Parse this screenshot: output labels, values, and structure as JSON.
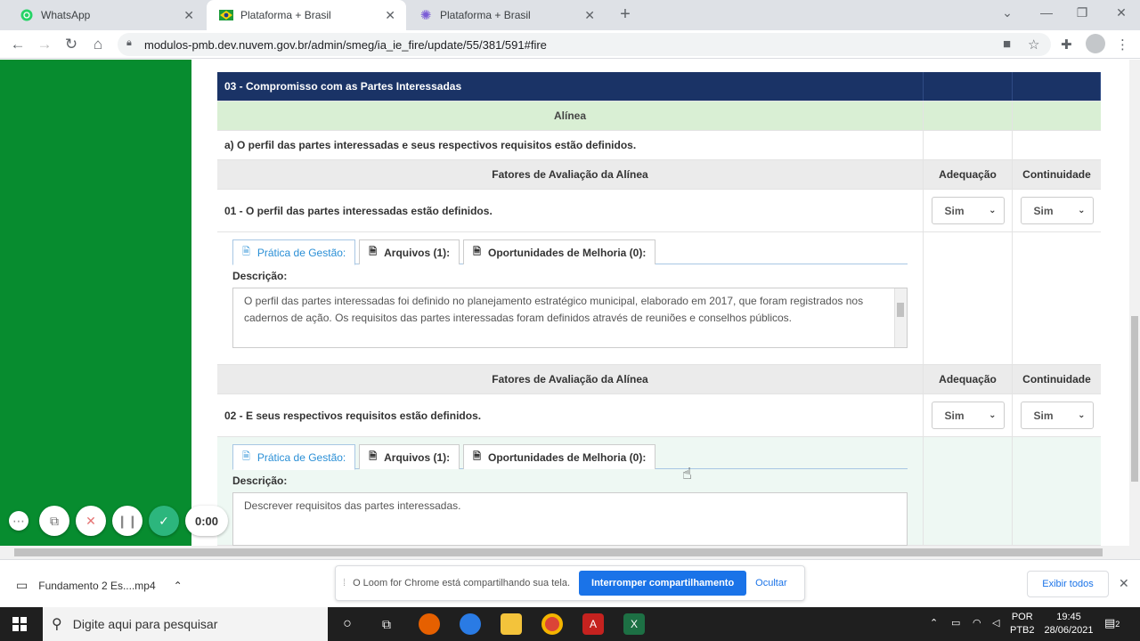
{
  "browser": {
    "tabs": [
      {
        "title": "WhatsApp",
        "active": false
      },
      {
        "title": "Plataforma + Brasil",
        "active": true
      },
      {
        "title": "Plataforma + Brasil",
        "active": false
      }
    ],
    "url": "modulos-pmb.dev.nuvem.gov.br/admin/smeg/ia_ie_fire/update/55/381/591#fire"
  },
  "section": {
    "title": "03 - Compromisso com as Partes Interessadas",
    "alinea_label": "Alínea",
    "alinea_text": "a) O perfil das partes interessadas e seus respectivos requisitos estão definidos.",
    "factors_header": "Fatores de Avaliação da Alínea",
    "adequacao_label": "Adequação",
    "continuidade_label": "Continuidade"
  },
  "factors": [
    {
      "title": "01 - O perfil das partes interessadas estão definidos.",
      "adequacao": "Sim",
      "continuidade": "Sim",
      "tab_pratica": "Prática de Gestão:",
      "tab_arquivos": "Arquivos (1):",
      "tab_oportunidades": "Oportunidades de Melhoria (0):",
      "desc_label": "Descrição:",
      "description": "O perfil das partes interessadas foi definido no planejamento estratégico municipal, elaborado em 2017, que foram registrados nos cadernos de ação. Os requisitos das partes interessadas foram definidos através de reuniões e conselhos públicos."
    },
    {
      "title": "02 - E seus respectivos requisitos estão definidos.",
      "adequacao": "Sim",
      "continuidade": "Sim",
      "tab_pratica": "Prática de Gestão:",
      "tab_arquivos": "Arquivos (1):",
      "tab_oportunidades": "Oportunidades de Melhoria (0):",
      "desc_label": "Descrição:",
      "description": "Descrever requisitos das partes interessadas."
    }
  ],
  "loom": {
    "timer": "0:00",
    "banner_text": "O Loom for Chrome está compartilhando sua tela.",
    "stop_label": "Interromper compartilhamento",
    "hide_label": "Ocultar"
  },
  "downloads": {
    "file": "Fundamento 2 Es....mp4",
    "show_all": "Exibir todos"
  },
  "taskbar": {
    "search_placeholder": "Digite aqui para pesquisar",
    "lang": "POR",
    "layout": "PTB2",
    "time": "19:45",
    "date": "28/06/2021",
    "notifications": "2"
  },
  "colors": {
    "sidebar": "#078c2f",
    "header": "#1a3366",
    "alinea_bg": "#d9efd4",
    "accent": "#1a73e8"
  }
}
